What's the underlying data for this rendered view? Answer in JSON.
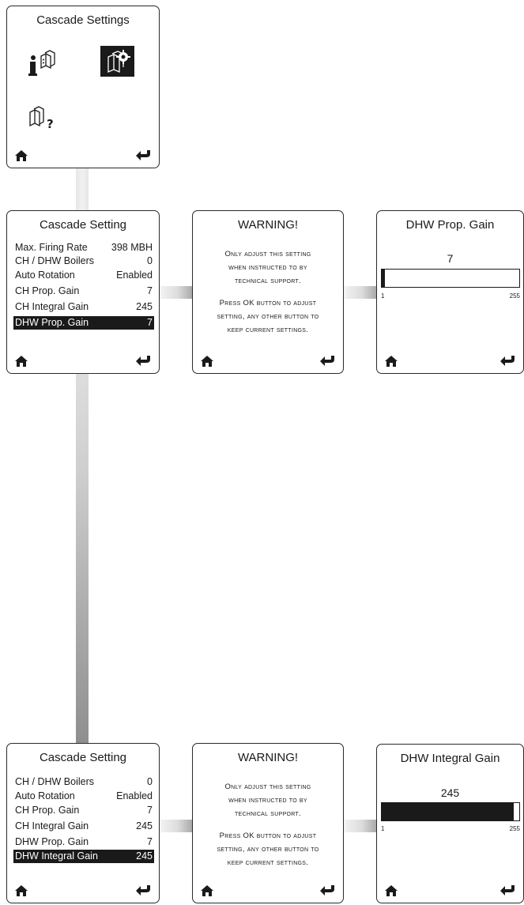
{
  "menu": {
    "title": "Cascade Settings",
    "icons": [
      "info-boilers-icon",
      "settings-boilers-icon",
      "help-boilers-icon"
    ]
  },
  "list1": {
    "title": "Cascade Setting",
    "rows": [
      {
        "label": "Max. Firing Rate",
        "value": "398 MBH"
      },
      {
        "label": "CH / DHW Boilers",
        "value": "0"
      },
      {
        "label": "Auto Rotation",
        "value": "Enabled"
      },
      {
        "label": "CH Prop. Gain",
        "value": "7"
      },
      {
        "label": "CH Integral Gain",
        "value": "245"
      },
      {
        "label": "DHW Prop. Gain",
        "value": "7"
      }
    ]
  },
  "warning1": {
    "title": "WARNING!",
    "lines": [
      "Only adjust this setting",
      "when instructed to by",
      "technical support.",
      "Press OK button to adjust",
      "setting, any other button to",
      "keep current settings."
    ]
  },
  "gauge1": {
    "title": "DHW Prop. Gain",
    "value": "7",
    "min": "1",
    "max": "255",
    "fill_fraction": 0.024
  },
  "list2": {
    "title": "Cascade Setting",
    "rows": [
      {
        "label": "CH / DHW Boilers",
        "value": "0"
      },
      {
        "label": "Auto Rotation",
        "value": "Enabled"
      },
      {
        "label": "CH Prop. Gain",
        "value": "7"
      },
      {
        "label": "CH Integral Gain",
        "value": "245"
      },
      {
        "label": "DHW Prop. Gain",
        "value": "7"
      },
      {
        "label": "DHW Integral Gain",
        "value": "245"
      }
    ]
  },
  "warning2": {
    "title": "WARNING!",
    "lines": [
      "Only adjust this setting",
      "when instructed to by",
      "technical support.",
      "Press OK button to adjust",
      "setting, any other button to",
      "keep current settings."
    ]
  },
  "gauge2": {
    "title": "DHW Integral Gain",
    "value": "245",
    "min": "1",
    "max": "255",
    "fill_fraction": 0.96
  },
  "colors": {
    "screen_border": "#2a2a2a",
    "selection": "#1a1a1a"
  }
}
